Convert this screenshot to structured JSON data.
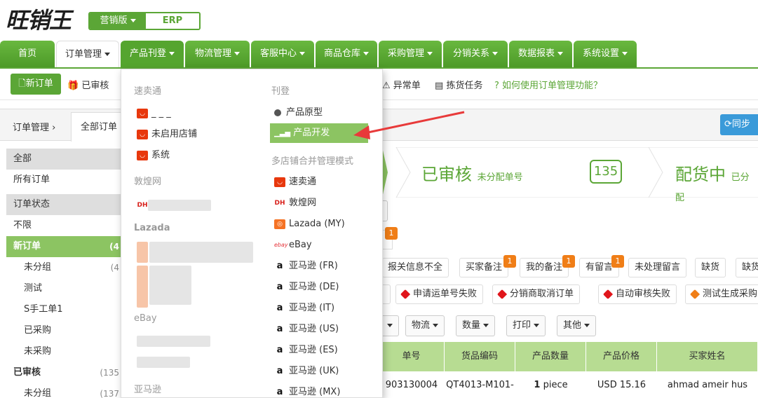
{
  "header": {
    "logo": "旺销王",
    "edition": "营销版",
    "erp": "ERP"
  },
  "nav": {
    "items": [
      "首页",
      "订单管理",
      "产品刊登",
      "物流管理",
      "客服中心",
      "商品仓库",
      "采购管理",
      "分销关系",
      "数据报表",
      "系统设置"
    ]
  },
  "toolbar": {
    "new_order": "新订单",
    "audited": "已审核",
    "abnormal": "异常单",
    "picking": "拣货任务",
    "howto": "如何使用订单管理功能？"
  },
  "breadcrumb": {
    "root": "订单管理",
    "tab": "全部订单"
  },
  "sidebar": {
    "rows": [
      {
        "label": "全部",
        "num": "",
        "kind": "head"
      },
      {
        "label": "所有订单",
        "num": "",
        "kind": "item"
      },
      {
        "label": "订单状态",
        "num": "",
        "kind": "head"
      },
      {
        "label": "不限",
        "num": "",
        "kind": "item"
      },
      {
        "label": "新订单",
        "num": "(4",
        "kind": "active"
      },
      {
        "label": "未分组",
        "num": "(4",
        "kind": "sub"
      },
      {
        "label": "测试",
        "num": "",
        "kind": "sub"
      },
      {
        "label": "S手工单1",
        "num": "",
        "kind": "sub"
      },
      {
        "label": "已采购",
        "num": "",
        "kind": "sub"
      },
      {
        "label": "未采购",
        "num": "",
        "kind": "sub"
      },
      {
        "label": "已审核",
        "num": "(135",
        "kind": "bold"
      },
      {
        "label": "未分组",
        "num": "(137",
        "kind": "sub"
      }
    ]
  },
  "dropdown": {
    "col1": {
      "h_smt": "速卖通",
      "smt_items": [
        "_ _ _",
        "未启用店铺",
        "系统"
      ],
      "h_dh": "敦煌网",
      "h_laz": "Lazada",
      "h_ebay": "eBay",
      "h_amz": "亚马逊"
    },
    "col2": {
      "h_kd": "刊登",
      "prototype": "产品原型",
      "develop": "产品开发",
      "h_multi": "多店铺合并管理模式",
      "multi_items": [
        "速卖通",
        "敦煌网",
        "Lazada (MY)",
        "eBay",
        "亚马逊 (FR)",
        "亚马逊 (DE)",
        "亚马逊 (IT)",
        "亚马逊 (US)",
        "亚马逊 (ES)",
        "亚马逊 (UK)",
        "亚马逊 (MX)"
      ]
    }
  },
  "main": {
    "sync": "同步",
    "stage_audited": "已审核",
    "stage_audited_sub": "未分配单号",
    "stage_count": "135",
    "stage_picking": "配货中",
    "stage_picking_sub": "已分配",
    "badge_top": "1",
    "tags_row1": [
      {
        "label": "报关信息不全",
        "badge": ""
      },
      {
        "label": "买家备注",
        "badge": "1"
      },
      {
        "label": "我的备注",
        "badge": "1"
      },
      {
        "label": "有留言",
        "badge": "1"
      },
      {
        "label": "未处理留言",
        "badge": ""
      },
      {
        "label": "缺货",
        "badge": ""
      },
      {
        "label": "缺货",
        "badge": ""
      }
    ],
    "tags_row2": [
      {
        "label": "申请运单号失败"
      },
      {
        "label": "分销商取消订单"
      },
      {
        "label": "自动审核失败"
      },
      {
        "label": "测试生成采购"
      }
    ],
    "selects": [
      "物流",
      "数量",
      "打印",
      "其他"
    ],
    "columns": [
      "单号",
      "货品编码",
      "产品数量",
      "产品价格",
      "买家姓名"
    ],
    "row": {
      "order": "903130004",
      "sku": "QT4013-M101-",
      "qty_num": "1",
      "qty_unit": "piece",
      "price": "USD 15.16",
      "buyer": "ahmad ameir hus"
    }
  },
  "colors": {
    "green": "#5ba636",
    "light_green": "#8cc462",
    "header_green": "#b7dc92",
    "arrow": "#e83a3a",
    "badge": "#f07e17"
  }
}
